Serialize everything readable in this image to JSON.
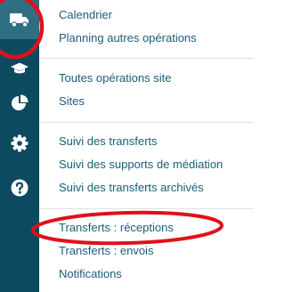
{
  "sidebar": {
    "items": [
      {
        "icon": "truck-icon",
        "active": true
      },
      {
        "icon": "graduation-cap-icon",
        "active": false
      },
      {
        "icon": "pie-chart-icon",
        "active": false
      },
      {
        "icon": "gear-icon",
        "active": false
      },
      {
        "icon": "help-icon",
        "active": false
      }
    ]
  },
  "menu": {
    "groups": [
      {
        "items": [
          {
            "label": "Calendrier"
          },
          {
            "label": "Planning autres opérations"
          }
        ]
      },
      {
        "items": [
          {
            "label": "Toutes opérations site"
          },
          {
            "label": "Sites"
          }
        ]
      },
      {
        "items": [
          {
            "label": "Suivi des transferts"
          },
          {
            "label": "Suivi des supports de médiation"
          },
          {
            "label": "Suivi des transferts archivés"
          }
        ]
      },
      {
        "items": [
          {
            "label": "Transferts : réceptions"
          },
          {
            "label": "Transferts : envois"
          },
          {
            "label": "Notifications"
          }
        ]
      }
    ]
  },
  "colors": {
    "sidebar_bg": "#0c4a60",
    "sidebar_active": "#2f6f84",
    "link": "#1c5d7a",
    "annotation": "#e0101a"
  },
  "annotations": [
    {
      "target": "truck-icon",
      "shape": "ellipse"
    },
    {
      "target": "Transferts : réceptions",
      "shape": "ellipse"
    }
  ]
}
